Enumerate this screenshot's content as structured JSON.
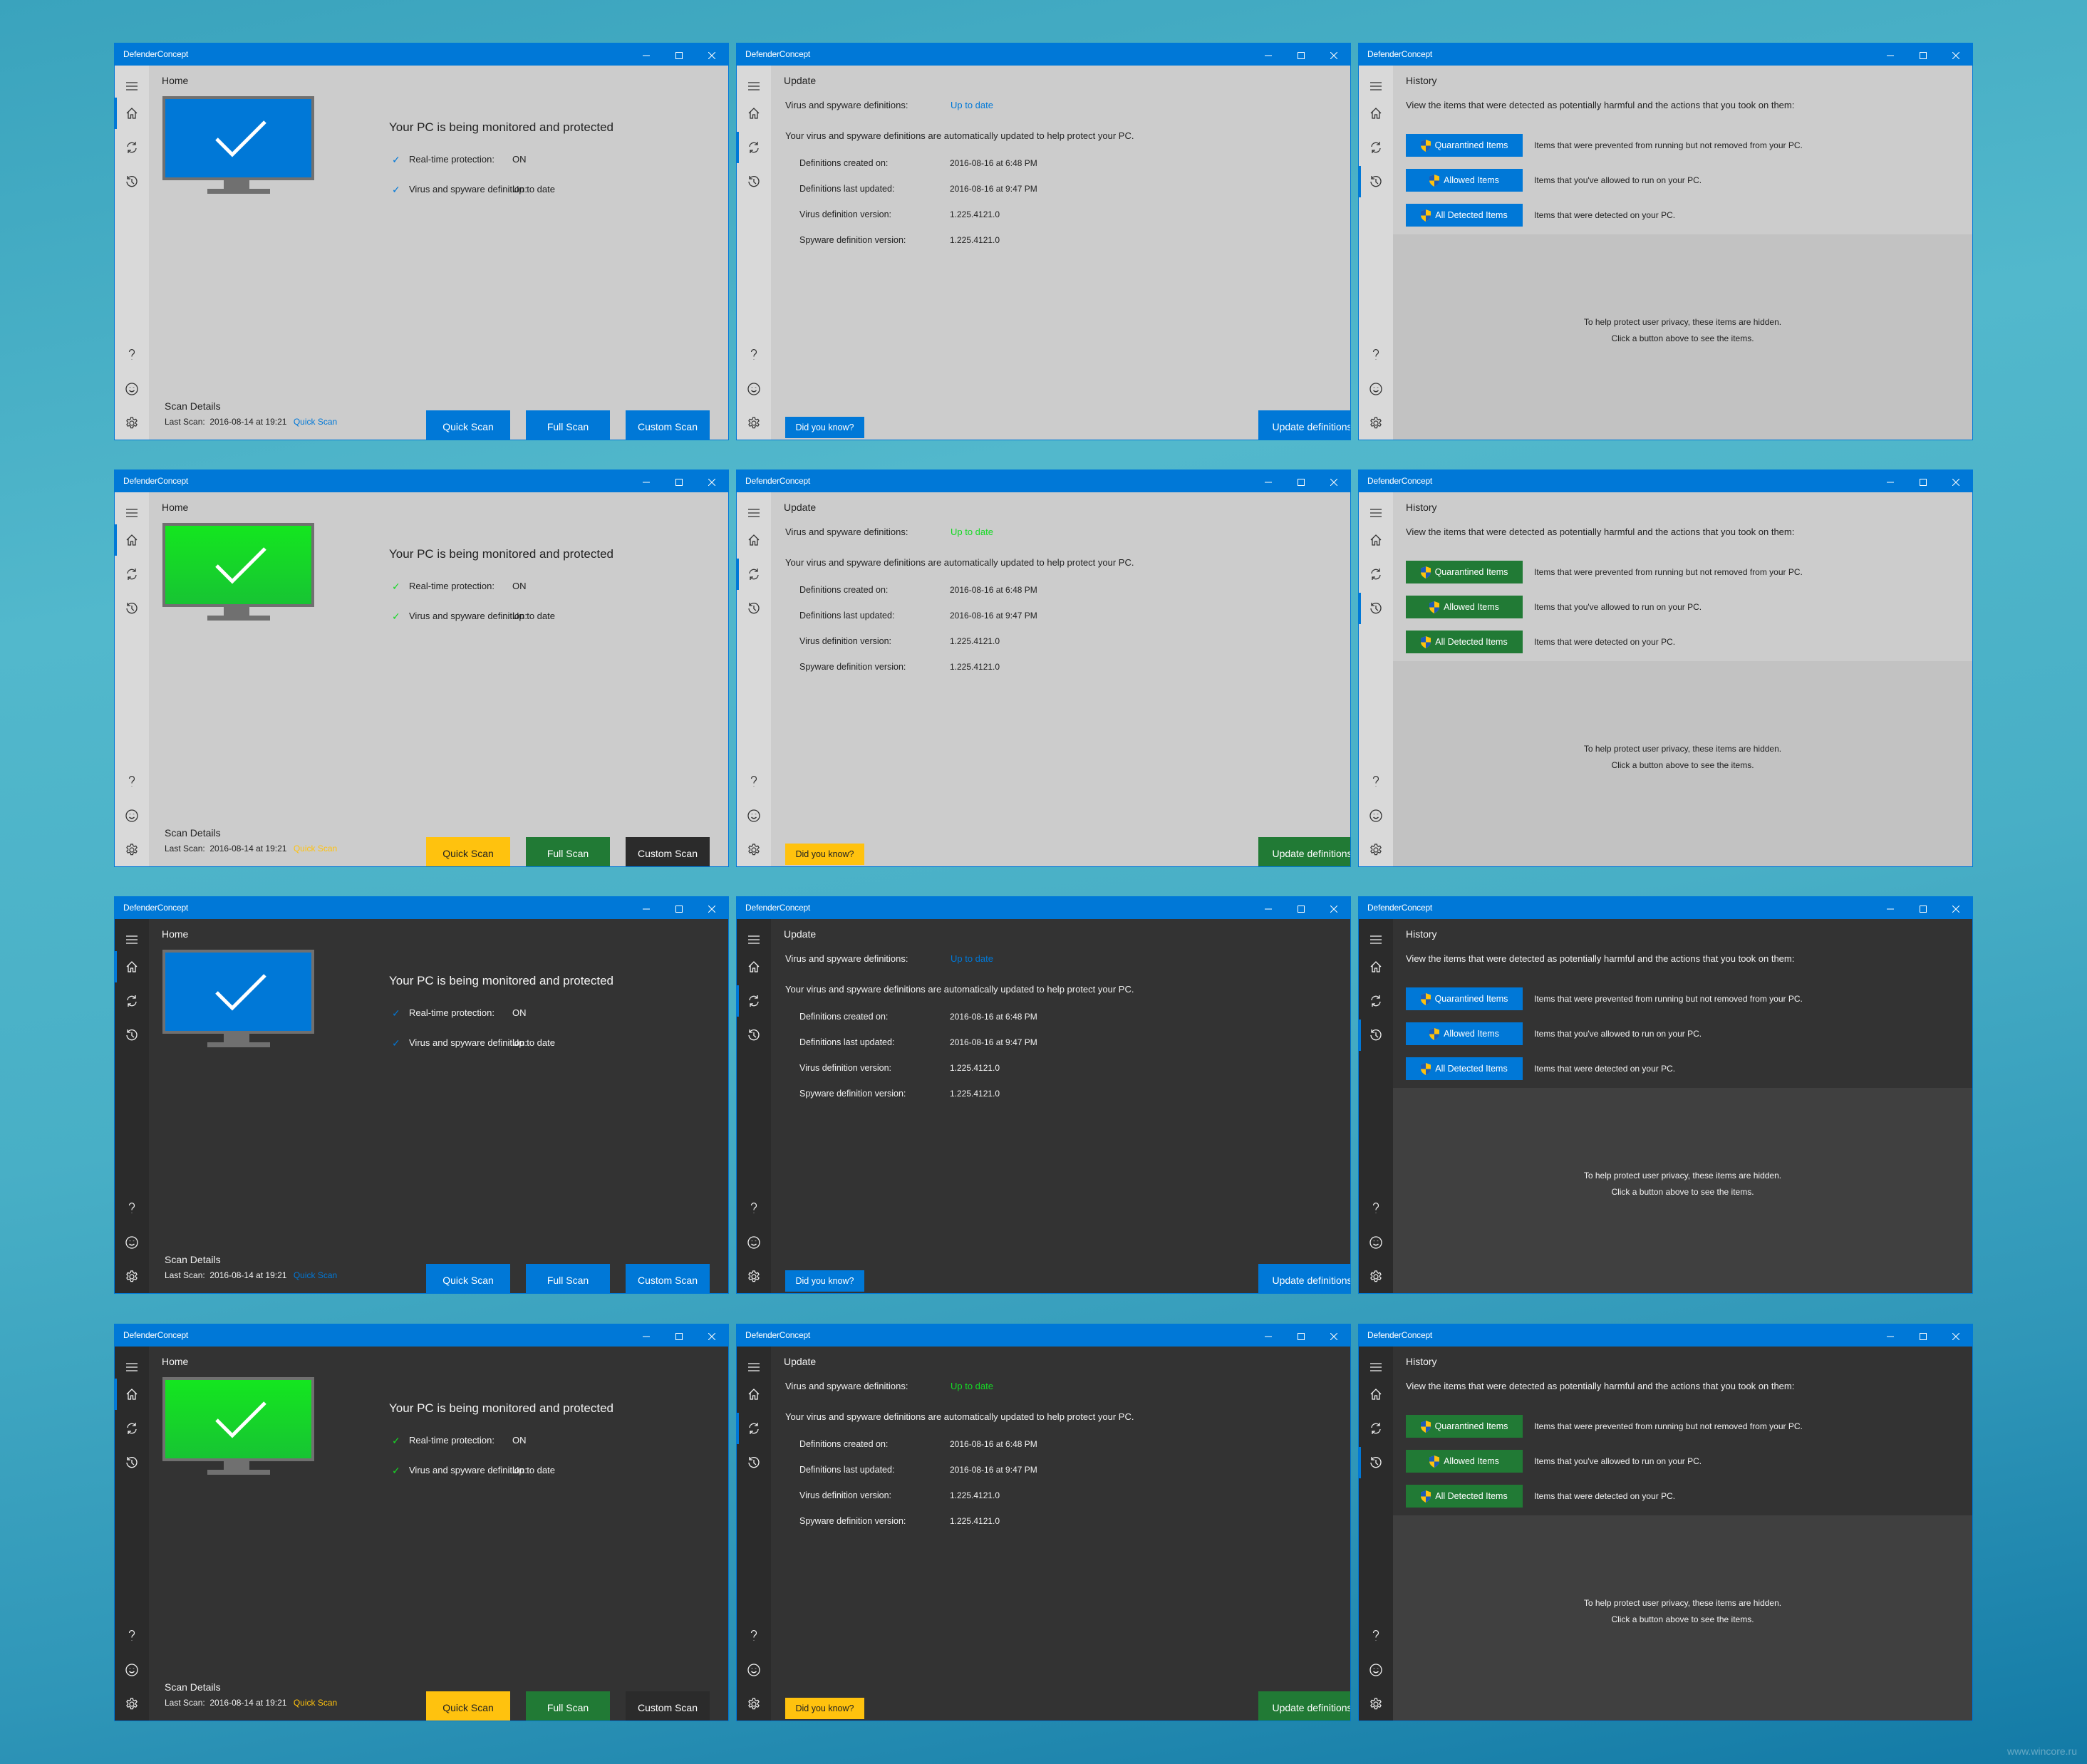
{
  "app_title": "DefenderConcept",
  "window_controls": {
    "minimize": "minimize",
    "maximize": "maximize",
    "close": "close"
  },
  "sidebar": {
    "items": [
      {
        "id": "menu",
        "icon": "hamburger-icon"
      },
      {
        "id": "home",
        "icon": "home-icon"
      },
      {
        "id": "update",
        "icon": "sync-icon"
      },
      {
        "id": "history",
        "icon": "history-icon"
      },
      {
        "id": "help",
        "icon": "help-icon"
      },
      {
        "id": "feedback",
        "icon": "smiley-icon"
      },
      {
        "id": "settings",
        "icon": "gear-icon"
      }
    ]
  },
  "home": {
    "title": "Home",
    "status_heading": "Your PC is being monitored and protected",
    "status_rows": [
      {
        "label": "Real-time protection:",
        "value": "ON"
      },
      {
        "label": "Virus and spyware definition:",
        "value": "Up to date"
      }
    ],
    "scan_details_title": "Scan Details",
    "last_scan_label": "Last Scan:",
    "last_scan_value": "2016-08-14 at 19:21",
    "last_scan_type": "Quick Scan",
    "buttons": {
      "quick": "Quick Scan",
      "full": "Full Scan",
      "custom": "Custom Scan"
    }
  },
  "update": {
    "title": "Update",
    "defs_label": "Virus and spyware definitions:",
    "defs_status": "Up to date",
    "auto_text": "Your virus and spyware definitions are automatically updated to help protect your PC.",
    "rows": [
      {
        "label": "Definitions created on:",
        "value": "2016-08-16 at 6:48 PM"
      },
      {
        "label": "Definitions last updated:",
        "value": "2016-08-16 at 9:47 PM"
      },
      {
        "label": "Virus definition version:",
        "value": "1.225.4121.0"
      },
      {
        "label": "Spyware definition version:",
        "value": "1.225.4121.0"
      }
    ],
    "did_you_know": "Did you know?",
    "update_button": "Update definitions"
  },
  "history": {
    "title": "History",
    "intro": "View the items that were detected as potentially harmful and the actions that you took on them:",
    "rows": [
      {
        "button": "Quarantined Items",
        "desc": "Items that were prevented from running but not removed from your PC."
      },
      {
        "button": "Allowed Items",
        "desc": "Items that you've allowed to run on your PC."
      },
      {
        "button": "All Detected Items",
        "desc": "Items that were detected on your PC."
      }
    ],
    "privacy_line1": "To help protect user privacy, these items are hidden.",
    "privacy_line2": "Click a button above to see the items."
  },
  "themes": [
    {
      "name": "light-blue",
      "mode": "light",
      "screen": "#0078d7",
      "check": "#0078d7",
      "accent_text": "#0078d7",
      "quick_bg": "#0078d7",
      "quick_fg": "#ffffff",
      "full_bg": "#0078d7",
      "custom_bg": "#0078d7",
      "dyk_bg": "#0078d7",
      "dyk_fg": "#ffffff",
      "upd_bg": "#0078d7",
      "hist_btn": "#0078d7",
      "last_scan_link": "#0078d7"
    },
    {
      "name": "light-green",
      "mode": "light",
      "screen": "#16d925",
      "check": "#16d925",
      "accent_text": "#16d925",
      "quick_bg": "#ffc20e",
      "quick_fg": "#222222",
      "full_bg": "#217a35",
      "custom_bg": "#2b2b2b",
      "dyk_bg": "#ffc20e",
      "dyk_fg": "#222222",
      "upd_bg": "#217a35",
      "hist_btn": "#217a35",
      "last_scan_link": "#ffc20e"
    },
    {
      "name": "dark-blue",
      "mode": "dark",
      "screen": "#0078d7",
      "check": "#0078d7",
      "accent_text": "#0078d7",
      "quick_bg": "#0078d7",
      "quick_fg": "#ffffff",
      "full_bg": "#0078d7",
      "custom_bg": "#0078d7",
      "dyk_bg": "#0078d7",
      "dyk_fg": "#ffffff",
      "upd_bg": "#0078d7",
      "hist_btn": "#0078d7",
      "last_scan_link": "#0078d7"
    },
    {
      "name": "dark-green",
      "mode": "dark",
      "screen": "#16d925",
      "check": "#16d925",
      "accent_text": "#16d925",
      "quick_bg": "#ffc20e",
      "quick_fg": "#222222",
      "full_bg": "#217a35",
      "custom_bg": "#2b2b2b",
      "dyk_bg": "#ffc20e",
      "dyk_fg": "#222222",
      "upd_bg": "#217a35",
      "hist_btn": "#217a35",
      "last_scan_link": "#ffc20e"
    }
  ],
  "watermark": "www.wincore.ru"
}
